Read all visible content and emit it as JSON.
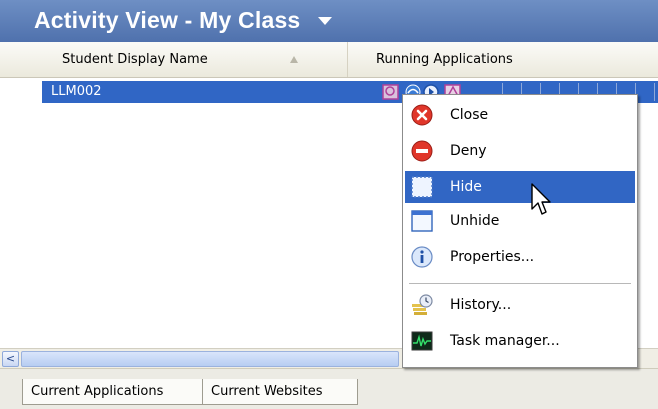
{
  "window": {
    "title": "Activity View - My Class"
  },
  "columns": {
    "name": "Student Display Name",
    "apps": "Running Applications"
  },
  "row": {
    "student": "LLM002"
  },
  "context_menu": {
    "items": [
      {
        "label": "Close",
        "icon": "close-icon"
      },
      {
        "label": "Deny",
        "icon": "deny-icon"
      },
      {
        "label": "Hide",
        "icon": "hide-icon",
        "highlighted": true
      },
      {
        "label": "Unhide",
        "icon": "unhide-icon"
      },
      {
        "label": "Properties...",
        "icon": "info-icon"
      },
      {
        "label": "History...",
        "icon": "history-icon"
      },
      {
        "label": "Task manager...",
        "icon": "task-manager-icon"
      }
    ]
  },
  "tabs": [
    {
      "label": "Current Applications"
    },
    {
      "label": "Current Websites"
    }
  ],
  "scrollbar": {
    "left_arrow": "<"
  },
  "colors": {
    "title_bar": "#5a7bb8",
    "selection": "#3066c5",
    "menu_highlight": "#3166c4"
  }
}
